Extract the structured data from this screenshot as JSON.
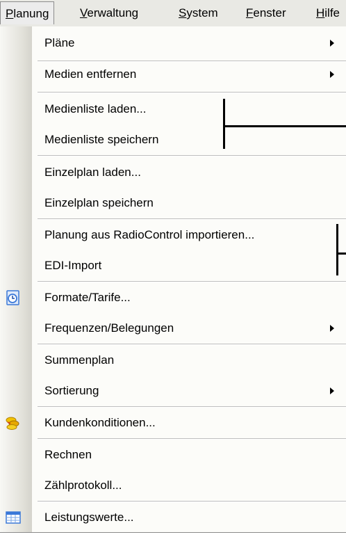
{
  "menubar": {
    "items": [
      {
        "label": "Planung",
        "accel": "P",
        "rest": "lanung"
      },
      {
        "label": "Verwaltung",
        "accel": "V",
        "rest": "erwaltung"
      },
      {
        "label": "System",
        "accel": "S",
        "rest": "ystem"
      },
      {
        "label": "Fenster",
        "accel": "F",
        "rest": "enster"
      },
      {
        "label": "Hilfe",
        "accel": "H",
        "rest": "ilfe"
      }
    ]
  },
  "menu": {
    "items": [
      {
        "label": "Pläne",
        "submenu": true
      },
      {
        "label": "Medien entfernen",
        "submenu": true
      },
      {
        "label": "Medienliste laden..."
      },
      {
        "label": "Medienliste speichern"
      },
      {
        "label": "Einzelplan laden..."
      },
      {
        "label": "Einzelplan speichern"
      },
      {
        "label": "Planung aus RadioControl importieren..."
      },
      {
        "label": "EDI-Import"
      },
      {
        "label": "Formate/Tarife...",
        "icon": "clock-document-icon"
      },
      {
        "label": "Frequenzen/Belegungen",
        "submenu": true
      },
      {
        "label": "Summenplan"
      },
      {
        "label": "Sortierung",
        "submenu": true
      },
      {
        "label": "Kundenkonditionen...",
        "icon": "coins-icon"
      },
      {
        "label": "Rechnen"
      },
      {
        "label": "Zählprotokoll..."
      },
      {
        "label": "Leistungswerte...",
        "icon": "table-icon"
      }
    ]
  },
  "colors": {
    "menubar_bg": "#e9e9e4",
    "menu_bg": "#fcfcf9",
    "separator": "#bebebe",
    "icon_blue": "#3a78d8",
    "icon_gold": "#e6b800",
    "icon_red": "#d03a1a"
  }
}
